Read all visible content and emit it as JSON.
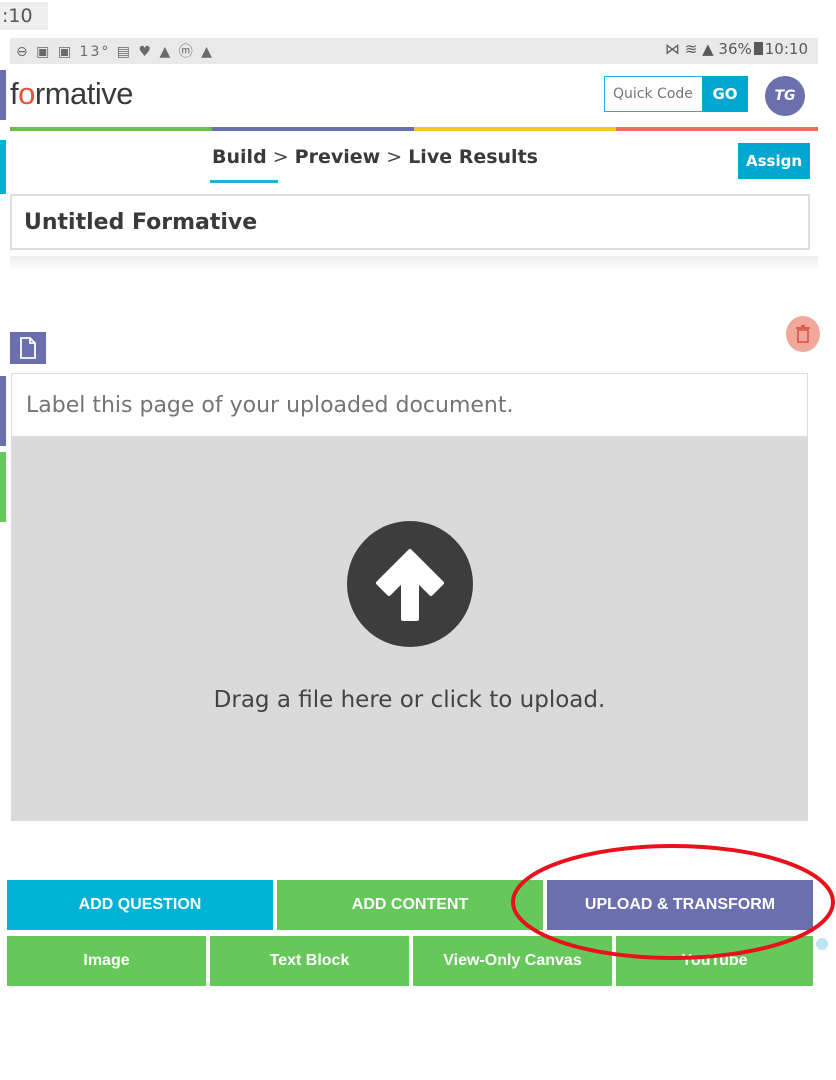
{
  "outer_time": ":10",
  "status_bar": {
    "left_icons": "⊖ ▣ ▣ 13° ▤ ♥ ▲ ⓜ ▲",
    "signal": "⋈ ≋ ▲",
    "battery": "36%",
    "time": "10:10"
  },
  "header": {
    "logo_pre": "f",
    "logo_o": "o",
    "logo_post": "rmative",
    "quick_code_placeholder": "Quick Code",
    "go_label": "GO",
    "avatar_initials": "TG"
  },
  "stripe_colors": [
    "#6cc04a",
    "#6c6fad",
    "#f7c62c",
    "#ee6a5b"
  ],
  "nav": {
    "build": "Build",
    "sep1": " > ",
    "preview": "Preview",
    "sep2": " > ",
    "live_results": "Live Results",
    "assign_label": "Assign"
  },
  "title": "Untitled Formative",
  "document": {
    "label_placeholder": "Label this page of your uploaded document.",
    "upload_text": "Drag a file here or click to upload."
  },
  "buttons": {
    "add_question": "ADD QUESTION",
    "add_content": "ADD CONTENT",
    "upload_transform": "UPLOAD & TRANSFORM",
    "image": "Image",
    "text_block": "Text Block",
    "view_only_canvas": "View-Only Canvas",
    "youtube": "YouTube"
  },
  "colors": {
    "accent_blue": "#00a7d0",
    "purple": "#6c6fad",
    "green": "#66c75a",
    "highlight_red": "#e8121c"
  }
}
